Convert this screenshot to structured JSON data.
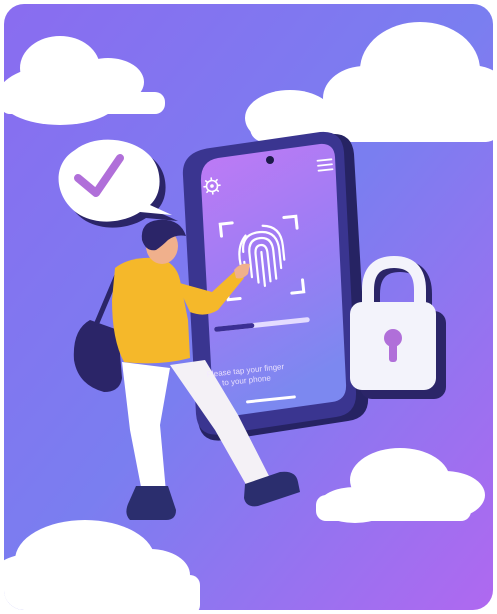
{
  "phone": {
    "prompt_line1": "Please tap your finger",
    "prompt_line2": "to your phone",
    "progress": 0.42
  },
  "icons": {
    "settings": "gear-icon",
    "menu": "hamburger-menu-icon",
    "fingerprint": "fingerprint-icon",
    "check": "check-icon",
    "lock": "padlock-icon"
  },
  "colors": {
    "bg_top": "#7c6cf0",
    "bg_bottom": "#6f8fe9",
    "bg_right": "#b36cf2",
    "phone_body": "#2d2d7a",
    "screen_top": "#b07cf4",
    "screen_bottom": "#7f86f2",
    "jacket": "#f5b82a",
    "check": "#b06fd9",
    "lock": "#f3f3fb"
  }
}
